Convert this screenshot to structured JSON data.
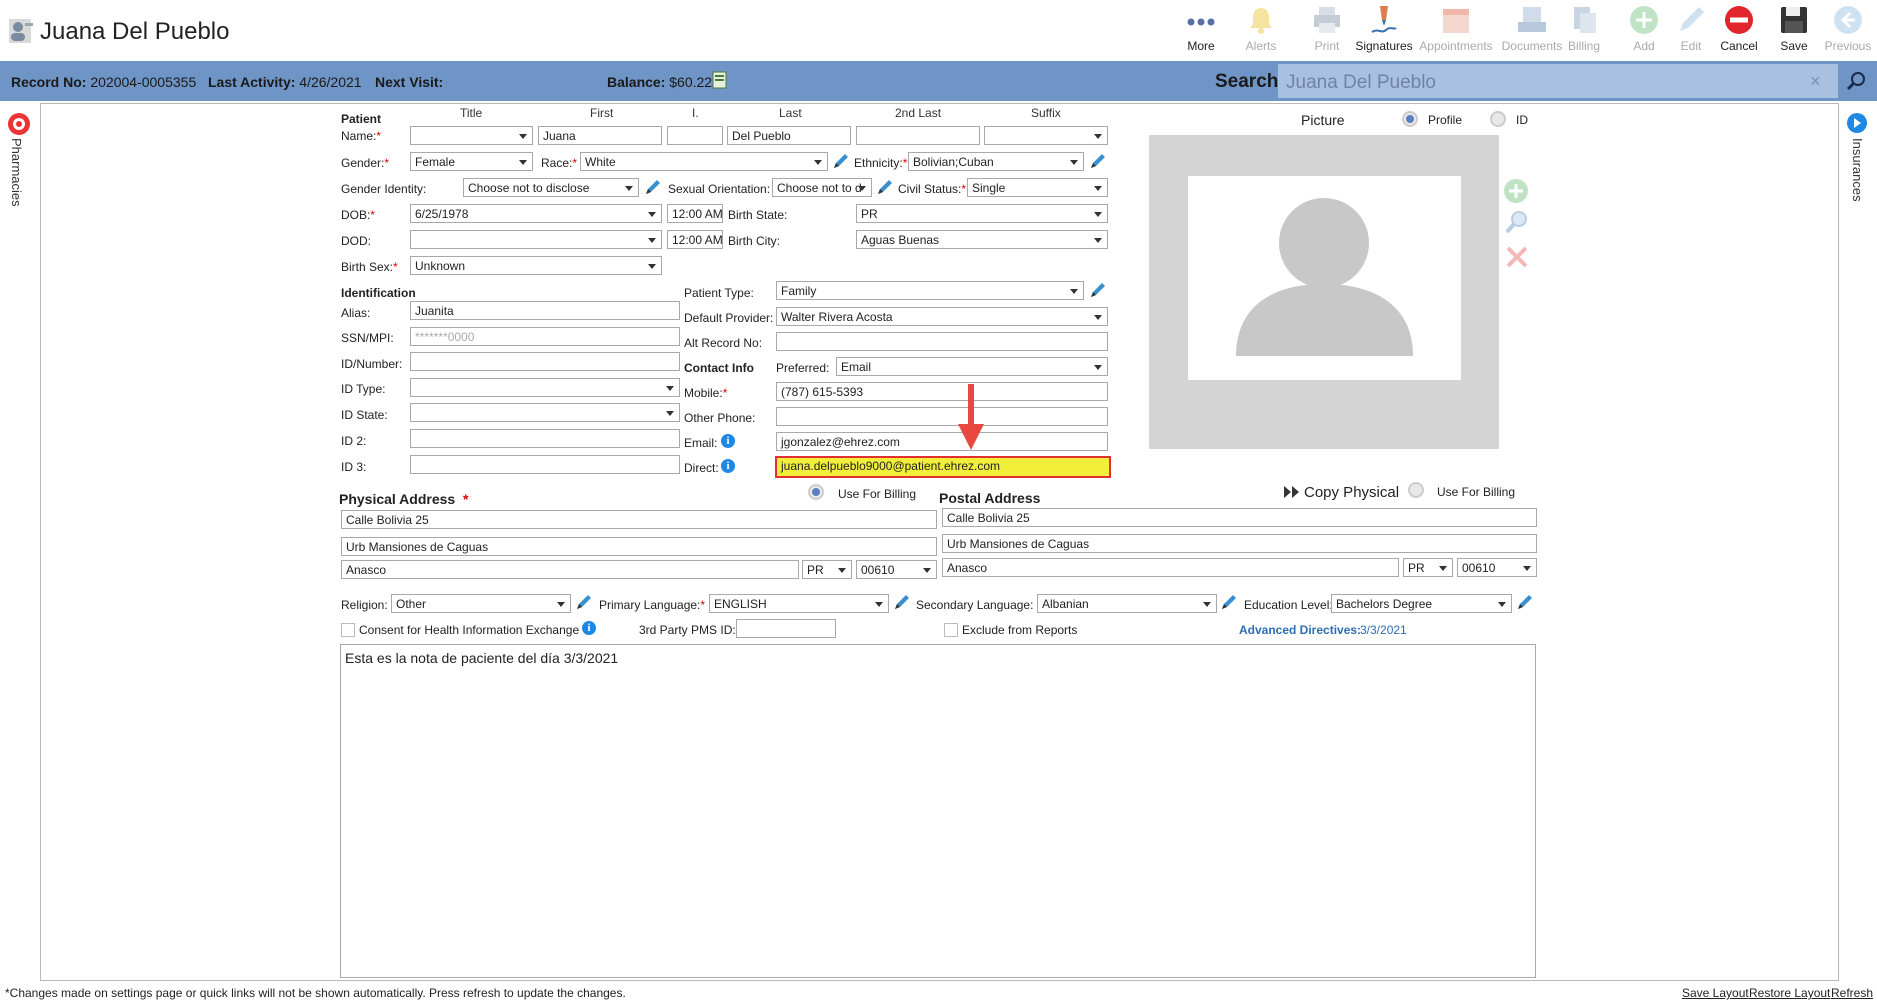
{
  "app": {
    "title": "Juana Del Pueblo"
  },
  "toolbar": [
    {
      "label": "More",
      "enabled": true
    },
    {
      "label": "Alerts",
      "enabled": false
    },
    {
      "label": "Print",
      "enabled": false
    },
    {
      "label": "Signatures",
      "enabled": true
    },
    {
      "label": "Appointments",
      "enabled": false
    },
    {
      "label": "Documents",
      "enabled": false
    },
    {
      "label": "Billing",
      "enabled": false
    },
    {
      "label": "Add",
      "enabled": false
    },
    {
      "label": "Edit",
      "enabled": false
    },
    {
      "label": "Cancel",
      "enabled": true
    },
    {
      "label": "Save",
      "enabled": true
    },
    {
      "label": "Previous",
      "enabled": false
    }
  ],
  "infobar": {
    "record_label": "Record No:",
    "record_value": "202004-0005355",
    "last_activity_label": "Last Activity:",
    "last_activity_value": "4/26/2021",
    "next_visit_label": "Next Visit:",
    "balance_label": "Balance:",
    "balance_value": "$60.22",
    "search_label": "Search:",
    "search_value": "Juana Del Pueblo"
  },
  "side": {
    "left": "Pharmacies",
    "right": "Insurances"
  },
  "patient": {
    "section": "Patient",
    "cols": {
      "title": "Title",
      "first": "First",
      "initial": "I.",
      "last": "Last",
      "second_last": "2nd Last",
      "suffix": "Suffix"
    },
    "name_label": "Name:",
    "title": "",
    "first": "Juana",
    "initial": "",
    "last": "Del Pueblo",
    "second_last": "",
    "suffix": "",
    "gender_label": "Gender:",
    "gender": "Female",
    "race_label": "Race:",
    "race": "White",
    "ethnicity_label": "Ethnicity:",
    "ethnicity": "Bolivian;Cuban",
    "gender_identity_label": "Gender Identity:",
    "gender_identity": "Choose not to disclose",
    "sexual_orientation_label": "Sexual Orientation:",
    "sexual_orientation": "Choose not to d",
    "civil_status_label": "Civil Status:",
    "civil_status": "Single",
    "dob_label": "DOB:",
    "dob": "6/25/1978",
    "dob_time": "12:00 AM",
    "birth_state_label": "Birth State:",
    "birth_state": "PR",
    "dod_label": "DOD:",
    "dod": "",
    "dod_time": "12:00 AM",
    "birth_city_label": "Birth City:",
    "birth_city": "Aguas Buenas",
    "birth_sex_label": "Birth Sex:",
    "birth_sex": "Unknown"
  },
  "identification": {
    "section": "Identification",
    "alias_label": "Alias:",
    "alias": "Juanita",
    "ssn_label": "SSN/MPI:",
    "ssn": "*******0000",
    "id_number_label": "ID/Number:",
    "id_number": "",
    "id_type_label": "ID Type:",
    "id_type": "",
    "id_state_label": "ID State:",
    "id_state": "",
    "id2_label": "ID 2:",
    "id2": "",
    "id3_label": "ID 3:",
    "id3": "",
    "patient_type_label": "Patient Type:",
    "patient_type": "Family",
    "default_provider_label": "Default Provider:",
    "default_provider": "Walter Rivera Acosta",
    "alt_record_label": "Alt Record No:",
    "alt_record": ""
  },
  "contact": {
    "section": "Contact Info",
    "preferred_label": "Preferred:",
    "preferred": "Email",
    "mobile_label": "Mobile:",
    "mobile": "(787) 615-5393",
    "other_phone_label": "Other Phone:",
    "other_phone": "",
    "email_label": "Email:",
    "email": "jgonzalez@ehrez.com",
    "direct_label": "Direct:",
    "direct": "juana.delpueblo9000@patient.ehrez.com"
  },
  "picture": {
    "label": "Picture",
    "profile_label": "Profile",
    "id_label": "ID"
  },
  "physical": {
    "title": "Physical Address",
    "use_billing": "Use For Billing",
    "line1": "Calle Bolivia 25",
    "line2": "Urb Mansiones de Caguas",
    "city": "Anasco",
    "state": "PR",
    "zip": "00610"
  },
  "postal": {
    "copy_label": "Copy Physical",
    "use_billing": "Use For Billing",
    "title": "Postal Address",
    "line1": "Calle Bolivia 25",
    "line2": "Urb Mansiones de Caguas",
    "city": "Anasco",
    "state": "PR",
    "zip": "00610"
  },
  "other": {
    "religion_label": "Religion:",
    "religion": "Other",
    "primary_lang_label": "Primary Language:",
    "primary_lang": "ENGLISH",
    "secondary_lang_label": "Secondary Language:",
    "secondary_lang": "Albanian",
    "education_label": "Education Level:",
    "education": "Bachelors Degree",
    "consent_label": "Consent for Health Information Exchange",
    "pms_label": "3rd Party PMS ID:",
    "pms": "",
    "exclude_label": "Exclude from Reports",
    "adv_label": "Advanced Directives:",
    "adv_value": "3/3/2021",
    "notes": "Esta es la nota de paciente del día 3/3/2021"
  },
  "footer": {
    "note": "*Changes made on settings page or quick links will not be shown automatically. Press refresh to update the changes.",
    "save_layout": "Save Layout",
    "restore_layout": "Restore Layout",
    "refresh": "Refresh"
  },
  "colors": {
    "infobar": "#6f95c6",
    "highlight": "#f2ef3a",
    "highlight_border": "#e03030",
    "arrow": "#e8483e"
  }
}
